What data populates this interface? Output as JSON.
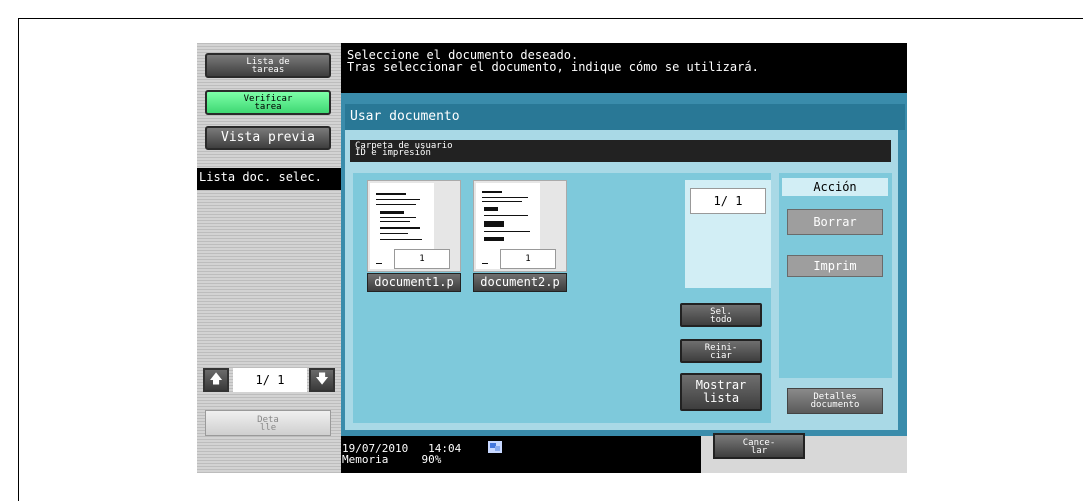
{
  "sidebar": {
    "job_list": "Lista de\ntareas",
    "check_job": "Verificar\ntarea",
    "preview": "Vista previa",
    "selected_list": "Lista doc. selec.",
    "pager": "1/  1",
    "detail": "Deta\nlle"
  },
  "message": {
    "line1": "Seleccione el documento deseado.",
    "line2": "Tras seleccionar el documento, indique cómo se utilizará."
  },
  "dialog": {
    "title": "Usar documento",
    "folder_line1": "Carpeta de usuario",
    "folder_line2": "ID e impresión",
    "documents": [
      {
        "name": "document1.p",
        "page": "1"
      },
      {
        "name": "document2.p",
        "page": "1"
      }
    ],
    "page_indicator": "1/  1",
    "select_all": "Sel.\ntodo",
    "reset": "Reini-\nciar",
    "show_list": "Mostrar\nlista",
    "action_title": "Acción",
    "delete": "Borrar",
    "print": "Imprim",
    "doc_details": "Detalles\ndocumento"
  },
  "status": {
    "date": "19/07/2010",
    "time": "14:04",
    "memory_label": "Memoria",
    "memory_value": "90%",
    "cancel": "Cance-\nlar"
  },
  "colors": {
    "accent_green": "#55e68c",
    "dialog_teal": "#3a8cab",
    "panel_light": "#a9d9e6"
  }
}
